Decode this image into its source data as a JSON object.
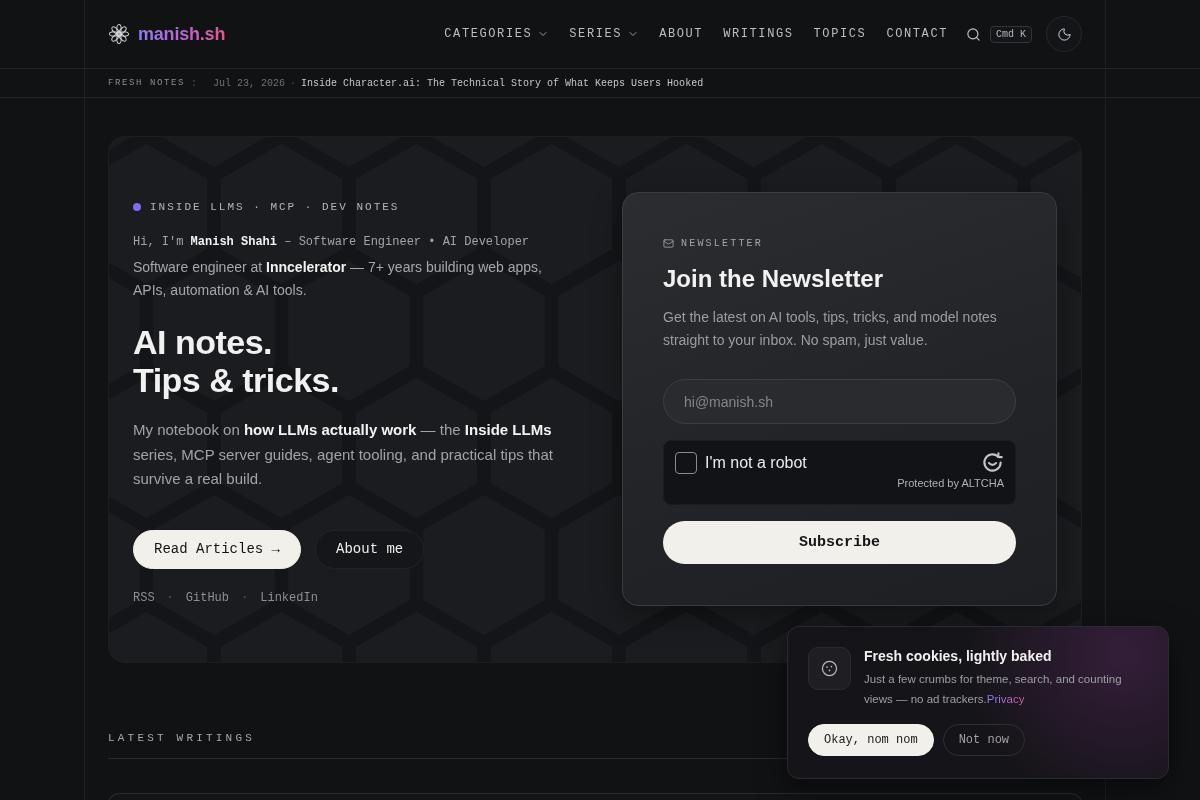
{
  "header": {
    "logo_text": "manish.sh",
    "nav": [
      {
        "label": "CATEGORIES",
        "dropdown": true
      },
      {
        "label": "SERIES",
        "dropdown": true
      },
      {
        "label": "ABOUT",
        "dropdown": false
      },
      {
        "label": "WRITINGS",
        "dropdown": false
      },
      {
        "label": "TOPICS",
        "dropdown": false
      },
      {
        "label": "CONTACT",
        "dropdown": false
      }
    ],
    "shortcut": "Cmd K"
  },
  "fresh_notes": {
    "label": "FRESH NOTES",
    "label_separator": ":",
    "date": "Jul 23, 2026",
    "separator": "·",
    "title": "Inside Character.ai: The Technical Story of What Keeps Users Hooked"
  },
  "hero": {
    "tagline": "INSIDE LLMS · MCP · DEV NOTES",
    "intro": "Hi, I'm **Manish Shahi** – Software Engineer • AI Developer",
    "bio": "Software engineer at **Inncelerator** — 7+ years building web apps, APIs, automation & AI tools.",
    "headline_lines": [
      "AI notes.",
      "Tips & tricks."
    ],
    "description": "My notebook on **how LLMs actually work** — the **Inside LLMs** series, MCP server guides, agent tooling, and practical tips that survive a real build.",
    "buttons": [
      {
        "label": "Read Articles →",
        "kind": "primary"
      },
      {
        "label": "About me",
        "kind": "secondary"
      }
    ],
    "links": [
      {
        "kind": "link",
        "text": "RSS"
      },
      {
        "kind": "separator",
        "text": "·"
      },
      {
        "kind": "link",
        "text": "GitHub"
      },
      {
        "kind": "separator",
        "text": "·"
      },
      {
        "kind": "link",
        "text": "LinkedIn"
      }
    ]
  },
  "newsletter": {
    "eyebrow": "NEWSLETTER",
    "title": "Join the Newsletter",
    "description": "Get the latest on AI tools, tips, tricks, and model notes straight to your inbox. No spam, just value.",
    "email_placeholder": "hi@manish.sh",
    "captcha": {
      "label": "I'm not a robot",
      "checked": false,
      "footer": "Protected by ALTCHA"
    },
    "button": "Subscribe"
  },
  "latest": {
    "heading": "LATEST WRITINGS"
  },
  "cookie_banner": {
    "title": "Fresh cookies, lightly baked",
    "body": "Just a few crumbs for theme, search, and counting views — no ad trackers.",
    "link": "Privacy",
    "buttons": [
      {
        "label": "Okay, nom nom",
        "kind": "primary"
      },
      {
        "label": "Not now",
        "kind": "secondary"
      }
    ]
  }
}
